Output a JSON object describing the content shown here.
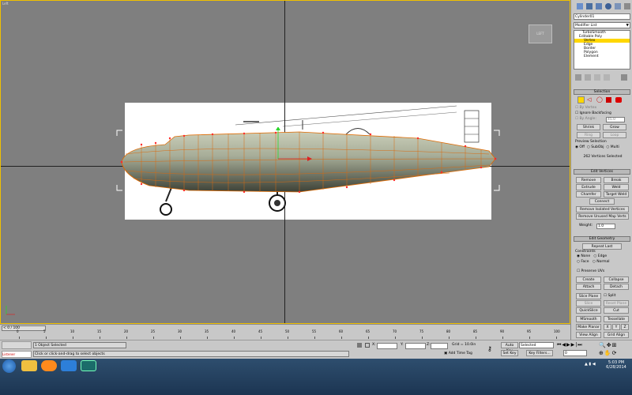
{
  "viewport": {
    "label": "Left",
    "viewcube": "LEFT"
  },
  "cmd": {
    "object_name": "Cylinder01",
    "modifier_list": "Modifier List",
    "stack": [
      "TurboSmooth",
      "Editable Poly",
      "Vertex",
      "Edge",
      "Border",
      "Polygon",
      "Element"
    ],
    "selection_title": "Selection",
    "by_vertex": "By Vertex",
    "ignore_backfacing": "Ignore Backfacing",
    "by_angle": "By Angle:",
    "by_angle_value": "45.0",
    "shrink": "Shrink",
    "grow": "Grow",
    "ring": "Ring",
    "loop": "Loop",
    "preview_selection": "Preview Selection",
    "off": "Off",
    "subobj": "SubObj",
    "multi": "Multi",
    "selected_count": "262 Vertices Selected",
    "edit_vertices_title": "Edit Vertices",
    "remove": "Remove",
    "break": "Break",
    "extrude": "Extrude",
    "weld": "Weld",
    "chamfer": "Chamfer",
    "target_weld": "Target Weld",
    "connect": "Connect",
    "remove_isolated": "Remove Isolated Vertices",
    "remove_unused": "Remove Unused Map Verts",
    "weight_label": "Weight:",
    "weight_value": "1.0",
    "edit_geometry_title": "Edit Geometry",
    "repeat_last": "Repeat Last",
    "constraints": "Constraints",
    "none": "None",
    "edge": "Edge",
    "face": "Face",
    "normal": "Normal",
    "preserve_uvs": "Preserve UVs",
    "create": "Create",
    "collapse": "Collapse",
    "attach": "Attach",
    "detach": "Detach",
    "slice_plane": "Slice Plane",
    "split": "Split",
    "slice": "Slice",
    "reset_plane": "Reset Plane",
    "quickslice": "QuickSlice",
    "cut": "Cut",
    "msmooth": "MSmooth",
    "tessellate": "Tessellate",
    "make_planar": "Make Planar",
    "x": "X",
    "y": "Y",
    "z": "Z",
    "view_align": "View Align",
    "grid_align": "Grid Align"
  },
  "timeline": {
    "frame": "0 / 100",
    "ticks": [
      "0",
      "5",
      "10",
      "15",
      "20",
      "25",
      "30",
      "35",
      "40",
      "45",
      "50",
      "55",
      "60",
      "65",
      "70",
      "75",
      "80",
      "85",
      "90",
      "95",
      "100"
    ]
  },
  "status": {
    "selection": "1 Object Selected",
    "prompt": "Click or click-and-drag to select objects",
    "script": "Listener",
    "x_label": "X:",
    "y_label": "Y:",
    "z_label": "Z:",
    "grid": "Grid = 10.0in",
    "add_time_tag": "Add Time Tag",
    "auto_key": "Auto Key",
    "set_key": "Set Key",
    "selected": "Selected",
    "key_filters": "Key Filters...",
    "frame_field": "0"
  },
  "taskbar": {
    "time": "5:03 PM",
    "date": "6/28/2014"
  }
}
